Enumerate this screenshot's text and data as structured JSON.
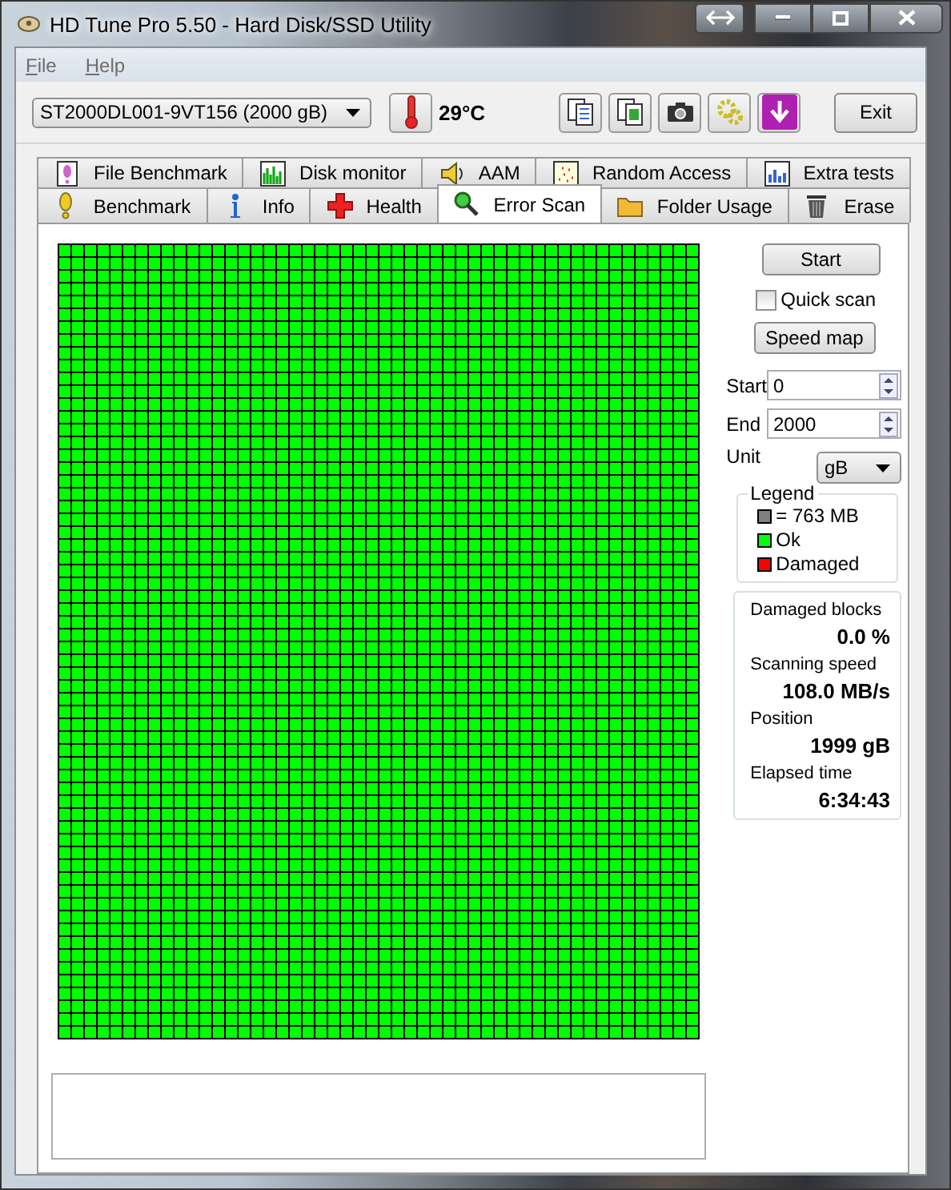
{
  "window": {
    "title": "HD Tune Pro 5.50 - Hard Disk/SSD Utility"
  },
  "menu": [
    {
      "label": "File"
    },
    {
      "label": "Help"
    }
  ],
  "toolbar": {
    "drive": "ST2000DL001-9VT156 (2000 gB)",
    "temperature": "29°C",
    "exit_button": "Exit"
  },
  "tabs": [
    [
      {
        "label": "File Benchmark",
        "selected": false
      },
      {
        "label": "Disk monitor",
        "selected": false
      },
      {
        "label": "AAM",
        "selected": false
      },
      {
        "label": "Random Access",
        "selected": false
      },
      {
        "label": "Extra tests",
        "selected": false
      }
    ],
    [
      {
        "label": "Benchmark",
        "selected": false
      },
      {
        "label": "Info",
        "selected": false
      },
      {
        "label": "Health",
        "selected": false
      },
      {
        "label": "Error Scan",
        "selected": true
      },
      {
        "label": "Folder Usage",
        "selected": false
      },
      {
        "label": "Erase",
        "selected": false
      }
    ]
  ],
  "block_map": {
    "damaged": false
  },
  "controls": {
    "start_button": "Start",
    "quick_scan": {
      "label": "Quick scan",
      "checked": false
    },
    "speed_map_button": "Speed map",
    "start": {
      "label": "Start",
      "value": "0"
    },
    "end": {
      "label": "End",
      "value": "2000"
    },
    "unit": {
      "label": "Unit",
      "value": "gB"
    }
  },
  "legend": {
    "title": "Legend",
    "items": [
      {
        "label": "= 763 MB",
        "color": "#808080"
      },
      {
        "label": "Ok",
        "color": "#00ff00"
      },
      {
        "label": "Damaged",
        "color": "#ff0000"
      }
    ]
  },
  "stats": [
    {
      "label": "Damaged blocks",
      "value": "0.0 %"
    },
    {
      "label": "Scanning speed",
      "value": "108.0 MB/s"
    },
    {
      "label": "Position",
      "value": "1999 gB"
    },
    {
      "label": "Elapsed time",
      "value": "6:34:43"
    }
  ]
}
